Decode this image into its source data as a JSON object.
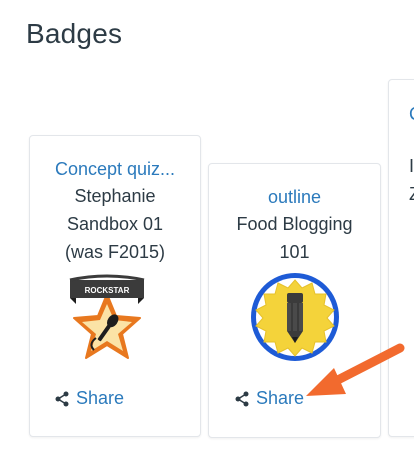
{
  "page": {
    "title": "Badges"
  },
  "badges": [
    {
      "name": "Concept quiz...",
      "course_lines": [
        "Stephanie",
        "Sandbox 01",
        "(was F2015)"
      ],
      "ribbon_text": "ROCKSTAR",
      "share_label": "Share"
    },
    {
      "name": "outline",
      "course_lines": [
        "Food Blogging",
        "101"
      ],
      "share_label": "Share"
    },
    {
      "name_peek": "C",
      "course_peek": [
        "I",
        "Z"
      ]
    }
  ],
  "icons": {
    "share": "share-icon",
    "rockstar_badge": "microphone-star-icon",
    "pencil_badge": "pencil-seal-icon",
    "arrow": "arrow-annotation-icon"
  },
  "colors": {
    "link": "#2b7abc",
    "text": "#2d3b45",
    "badge_orange": "#e8781f",
    "badge_yellow": "#f4d33a",
    "badge_blue": "#1e5bd6",
    "ribbon": "#3b3b3b",
    "arrow": "#f26a2e"
  }
}
